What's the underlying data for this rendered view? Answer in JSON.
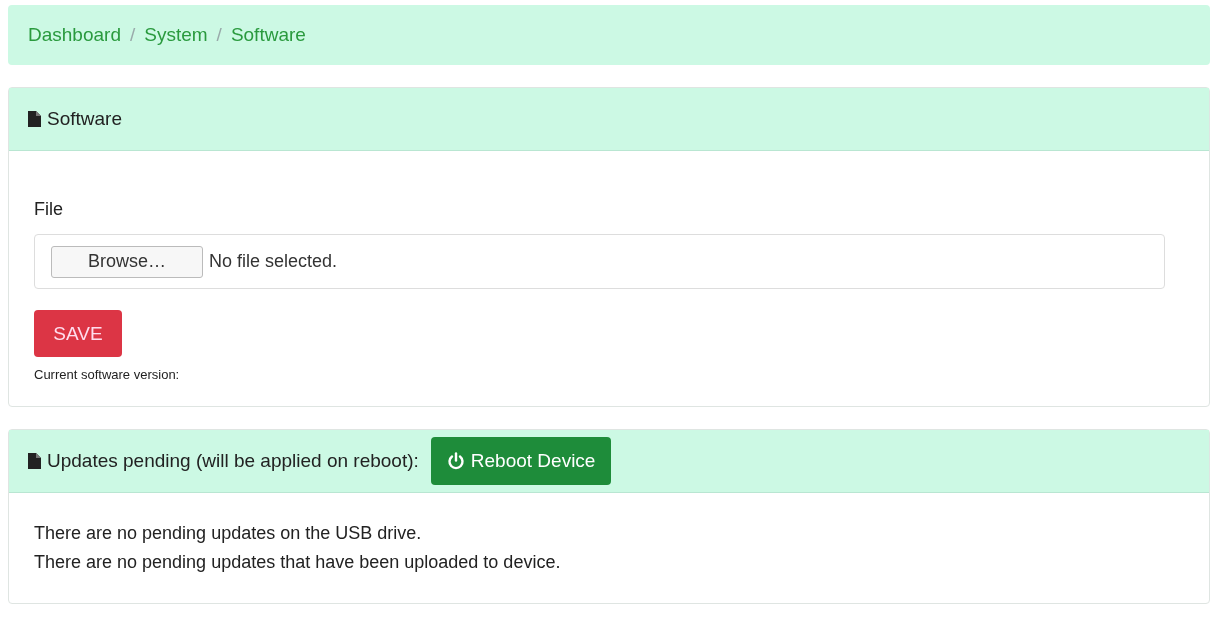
{
  "breadcrumb": {
    "separator": "/",
    "items": [
      {
        "label": "Dashboard"
      },
      {
        "label": "System"
      },
      {
        "label": "Software"
      }
    ]
  },
  "software_card": {
    "title": "Software",
    "field_label": "File",
    "browse_button": "Browse…",
    "file_status": "No file selected.",
    "save_button": "SAVE",
    "version_label": "Current software version:"
  },
  "updates_card": {
    "title": "Updates pending (will be applied on reboot):",
    "reboot_button": "Reboot Device",
    "messages": [
      "There are no pending updates on the USB drive.",
      "There are no pending updates that have been uploaded to device."
    ]
  }
}
